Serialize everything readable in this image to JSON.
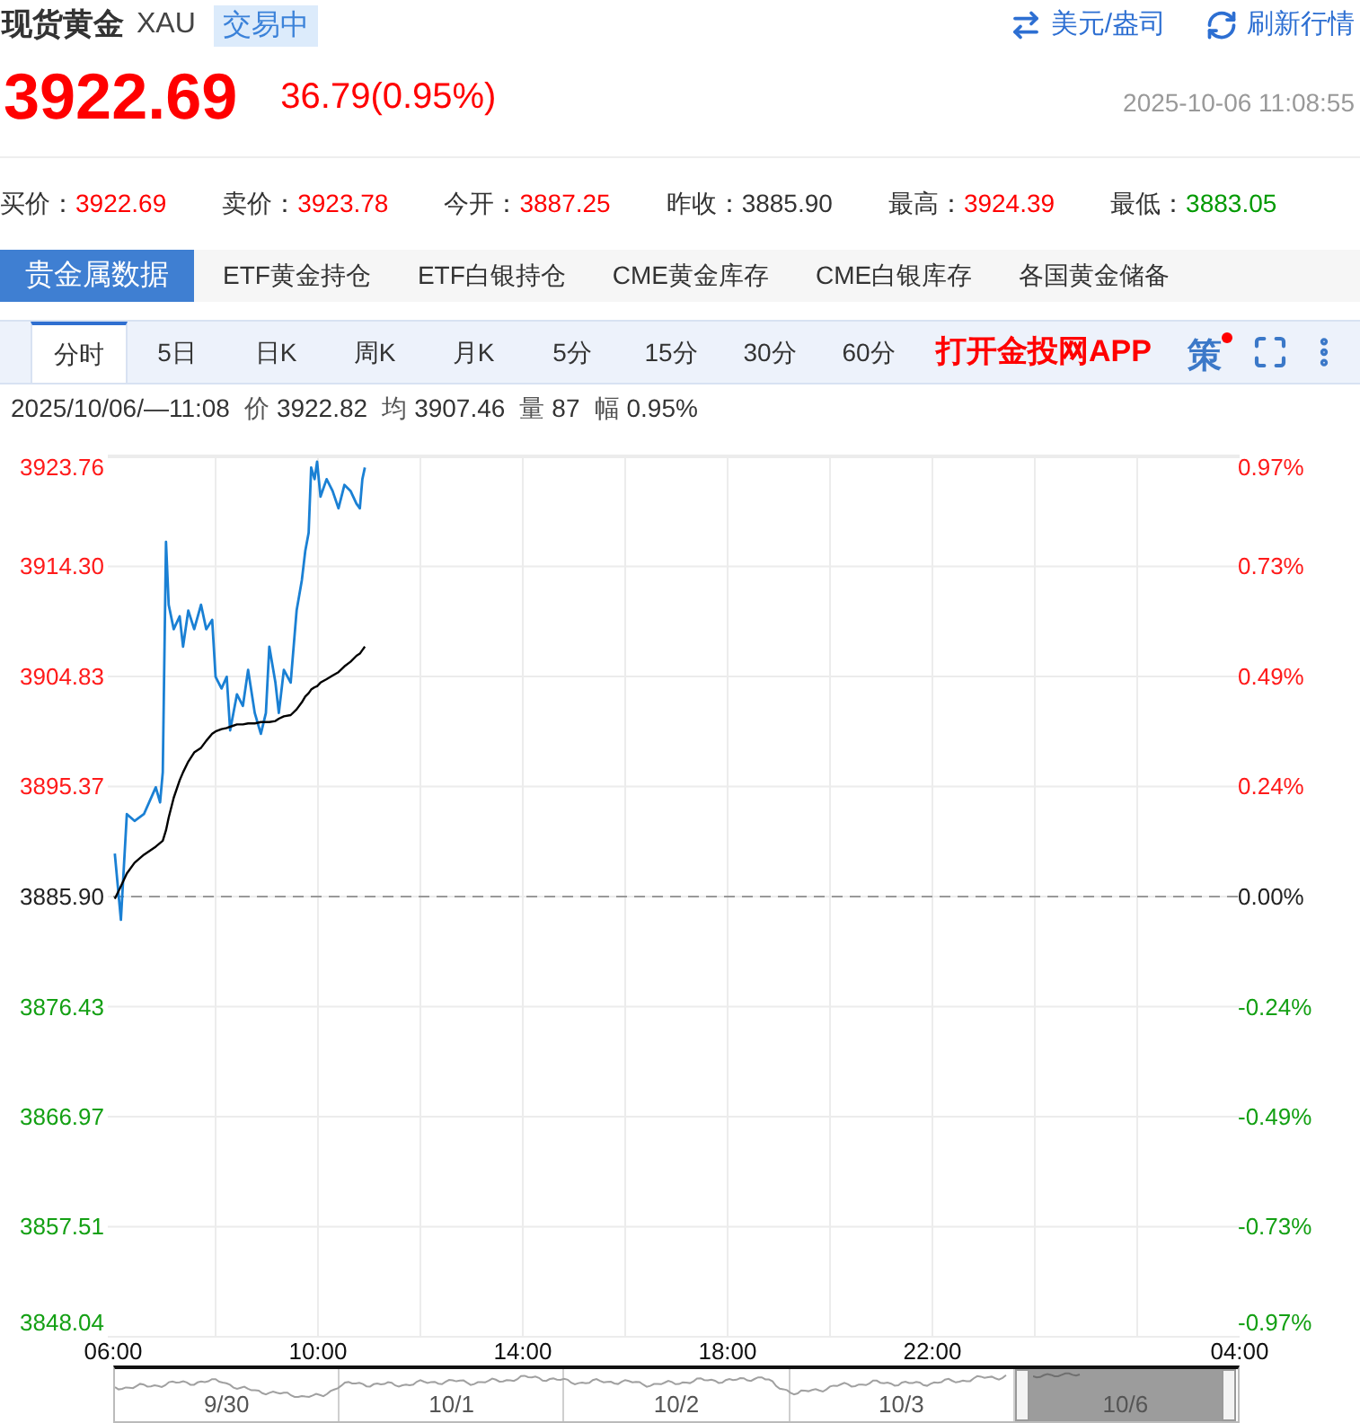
{
  "header": {
    "title": "现货黄金",
    "symbol": "XAU",
    "status": "交易中",
    "links": [
      {
        "kind": "swap",
        "label": "美元/盎司"
      },
      {
        "kind": "refresh",
        "label": "刷新行情"
      }
    ]
  },
  "quote": {
    "price": "3922.69",
    "change": "36.79(0.95%)",
    "time": "2025-10-06 11:08:55"
  },
  "stats": [
    {
      "label": "买价：",
      "value": "3922.69",
      "color": "#ff0000"
    },
    {
      "label": "卖价：",
      "value": "3923.78",
      "color": "#ff0000"
    },
    {
      "label": "今开：",
      "value": "3887.25",
      "color": "#ff0000"
    },
    {
      "label": "昨收：",
      "value": "3885.90",
      "color": "#333333"
    },
    {
      "label": "最高：",
      "value": "3924.39",
      "color": "#ff0000"
    },
    {
      "label": "最低：",
      "value": "3883.05",
      "color": "#009900"
    }
  ],
  "data_tabs": [
    {
      "label": "贵金属数据",
      "selected": true
    },
    {
      "label": "ETF黄金持仓",
      "selected": false
    },
    {
      "label": "ETF白银持仓",
      "selected": false
    },
    {
      "label": "CME黄金库存",
      "selected": false
    },
    {
      "label": "CME白银库存",
      "selected": false
    },
    {
      "label": "各国黄金储备",
      "selected": false
    }
  ],
  "period_tabs": [
    {
      "label": "分时",
      "selected": true
    },
    {
      "label": "5日",
      "selected": false
    },
    {
      "label": "日K",
      "selected": false
    },
    {
      "label": "周K",
      "selected": false
    },
    {
      "label": "月K",
      "selected": false
    },
    {
      "label": "5分",
      "selected": false
    },
    {
      "label": "15分",
      "selected": false
    },
    {
      "label": "30分",
      "selected": false
    },
    {
      "label": "60分",
      "selected": false
    }
  ],
  "app_link": "打开金投网APP",
  "tools": [
    {
      "kind": "strategy",
      "label": "策",
      "badge": true
    },
    {
      "kind": "fullscreen"
    },
    {
      "kind": "more"
    }
  ],
  "info": {
    "time": "2025/10/06/—11:08",
    "items": [
      {
        "label": "价",
        "value": "3922.82"
      },
      {
        "label": "均",
        "value": "3907.46"
      },
      {
        "label": "量",
        "value": "87"
      },
      {
        "label": "幅",
        "value": "0.95%"
      }
    ]
  },
  "chart": {
    "percent_labels": [
      "0.97%",
      "0.73%",
      "0.49%",
      "0.24%",
      "0.00%",
      "-0.24%",
      "-0.49%",
      "-0.73%",
      "-0.97%"
    ],
    "chart_data": {
      "type": "line",
      "x": [
        "2025-10-06T06:02",
        "2025-10-06T06:09",
        "2025-10-06T06:16",
        "2025-10-06T06:25",
        "2025-10-06T06:36",
        "2025-10-06T06:50",
        "2025-10-06T06:55",
        "2025-10-06T06:58",
        "2025-10-06T07:02",
        "2025-10-06T07:05",
        "2025-10-06T07:11",
        "2025-10-06T07:18",
        "2025-10-06T07:22",
        "2025-10-06T07:28",
        "2025-10-06T07:35",
        "2025-10-06T07:43",
        "2025-10-06T07:49",
        "2025-10-06T07:56",
        "2025-10-06T08:00",
        "2025-10-06T08:07",
        "2025-10-06T08:13",
        "2025-10-06T08:17",
        "2025-10-06T08:25",
        "2025-10-06T08:32",
        "2025-10-06T08:38",
        "2025-10-06T08:46",
        "2025-10-06T08:53",
        "2025-10-06T08:59",
        "2025-10-06T09:03",
        "2025-10-06T09:10",
        "2025-10-06T09:14",
        "2025-10-06T09:20",
        "2025-10-06T09:28",
        "2025-10-06T09:35",
        "2025-10-06T09:41",
        "2025-10-06T09:45",
        "2025-10-06T09:49",
        "2025-10-06T09:52",
        "2025-10-06T09:56",
        "2025-10-06T09:59",
        "2025-10-06T10:03",
        "2025-10-06T10:10",
        "2025-10-06T10:17",
        "2025-10-06T10:24",
        "2025-10-06T10:31",
        "2025-10-06T10:38",
        "2025-10-06T10:45",
        "2025-10-06T10:49",
        "2025-10-06T10:52",
        "2025-10-06T10:55"
      ],
      "series": [
        {
          "color": "#1a80d4",
          "values": [
            3889.6,
            3883.9,
            3893.0,
            3892.4,
            3893.0,
            3895.3,
            3894.0,
            3896.6,
            3916.4,
            3911.0,
            3908.9,
            3910.0,
            3907.4,
            3910.5,
            3908.9,
            3911.0,
            3908.9,
            3909.7,
            3904.8,
            3903.8,
            3904.8,
            3900.2,
            3903.3,
            3902.3,
            3905.4,
            3901.7,
            3899.9,
            3901.7,
            3907.4,
            3904.3,
            3901.7,
            3905.4,
            3904.3,
            3910.5,
            3913.1,
            3915.6,
            3917.2,
            3922.8,
            3921.8,
            3923.3,
            3920.3,
            3921.8,
            3920.8,
            3919.3,
            3921.3,
            3920.8,
            3919.7,
            3919.3,
            3921.8,
            3922.8
          ]
        },
        {
          "color": "#000000",
          "values": [
            3885.7,
            3886.8,
            3887.9,
            3888.8,
            3889.5,
            3890.2,
            3890.5,
            3890.7,
            3891.6,
            3892.7,
            3894.4,
            3895.9,
            3896.6,
            3897.5,
            3898.3,
            3898.7,
            3899.3,
            3899.9,
            3900.1,
            3900.3,
            3900.4,
            3900.5,
            3900.7,
            3900.7,
            3900.8,
            3900.8,
            3900.9,
            3900.9,
            3900.9,
            3901.0,
            3901.2,
            3901.4,
            3901.5,
            3902.0,
            3902.6,
            3903.1,
            3903.4,
            3903.7,
            3903.9,
            3904.0,
            3904.3,
            3904.6,
            3904.9,
            3905.2,
            3905.7,
            3906.1,
            3906.6,
            3906.8,
            3907.1,
            3907.4
          ]
        }
      ],
      "xlim": [
        "2025-10-06T06:00",
        "2025-10-07T04:00"
      ],
      "ylim": [
        3848.04,
        3923.76
      ],
      "xticks": [
        {
          "value": "2025-10-06T06:00",
          "label": "06:00"
        },
        {
          "value": "2025-10-06T10:00",
          "label": "10:00"
        },
        {
          "value": "2025-10-06T14:00",
          "label": "14:00"
        },
        {
          "value": "2025-10-06T18:00",
          "label": "18:00"
        },
        {
          "value": "2025-10-06T22:00",
          "label": "22:00"
        },
        {
          "value": "2025-10-07T04:00",
          "label": "04:00"
        }
      ],
      "yticks": [
        {
          "value": 3923.76,
          "label": "3923.76"
        },
        {
          "value": 3914.3,
          "label": "3914.30"
        },
        {
          "value": 3904.83,
          "label": "3904.83"
        },
        {
          "value": 3895.37,
          "label": "3895.37"
        },
        {
          "value": 3885.9,
          "label": "3885.90"
        },
        {
          "value": 3876.43,
          "label": "3876.43"
        },
        {
          "value": 3866.97,
          "label": "3866.97"
        },
        {
          "value": 3857.51,
          "label": "3857.51"
        },
        {
          "value": 3848.04,
          "label": "3848.04"
        }
      ],
      "grid": true,
      "ref_lines": [
        {
          "axis": "y",
          "value": 3885.9
        }
      ]
    }
  },
  "navigator": {
    "days": [
      {
        "label": "9/30",
        "selected": false
      },
      {
        "label": "10/1",
        "selected": false
      },
      {
        "label": "10/2",
        "selected": false
      },
      {
        "label": "10/3",
        "selected": false
      },
      {
        "label": "10/6",
        "selected": true
      }
    ]
  }
}
